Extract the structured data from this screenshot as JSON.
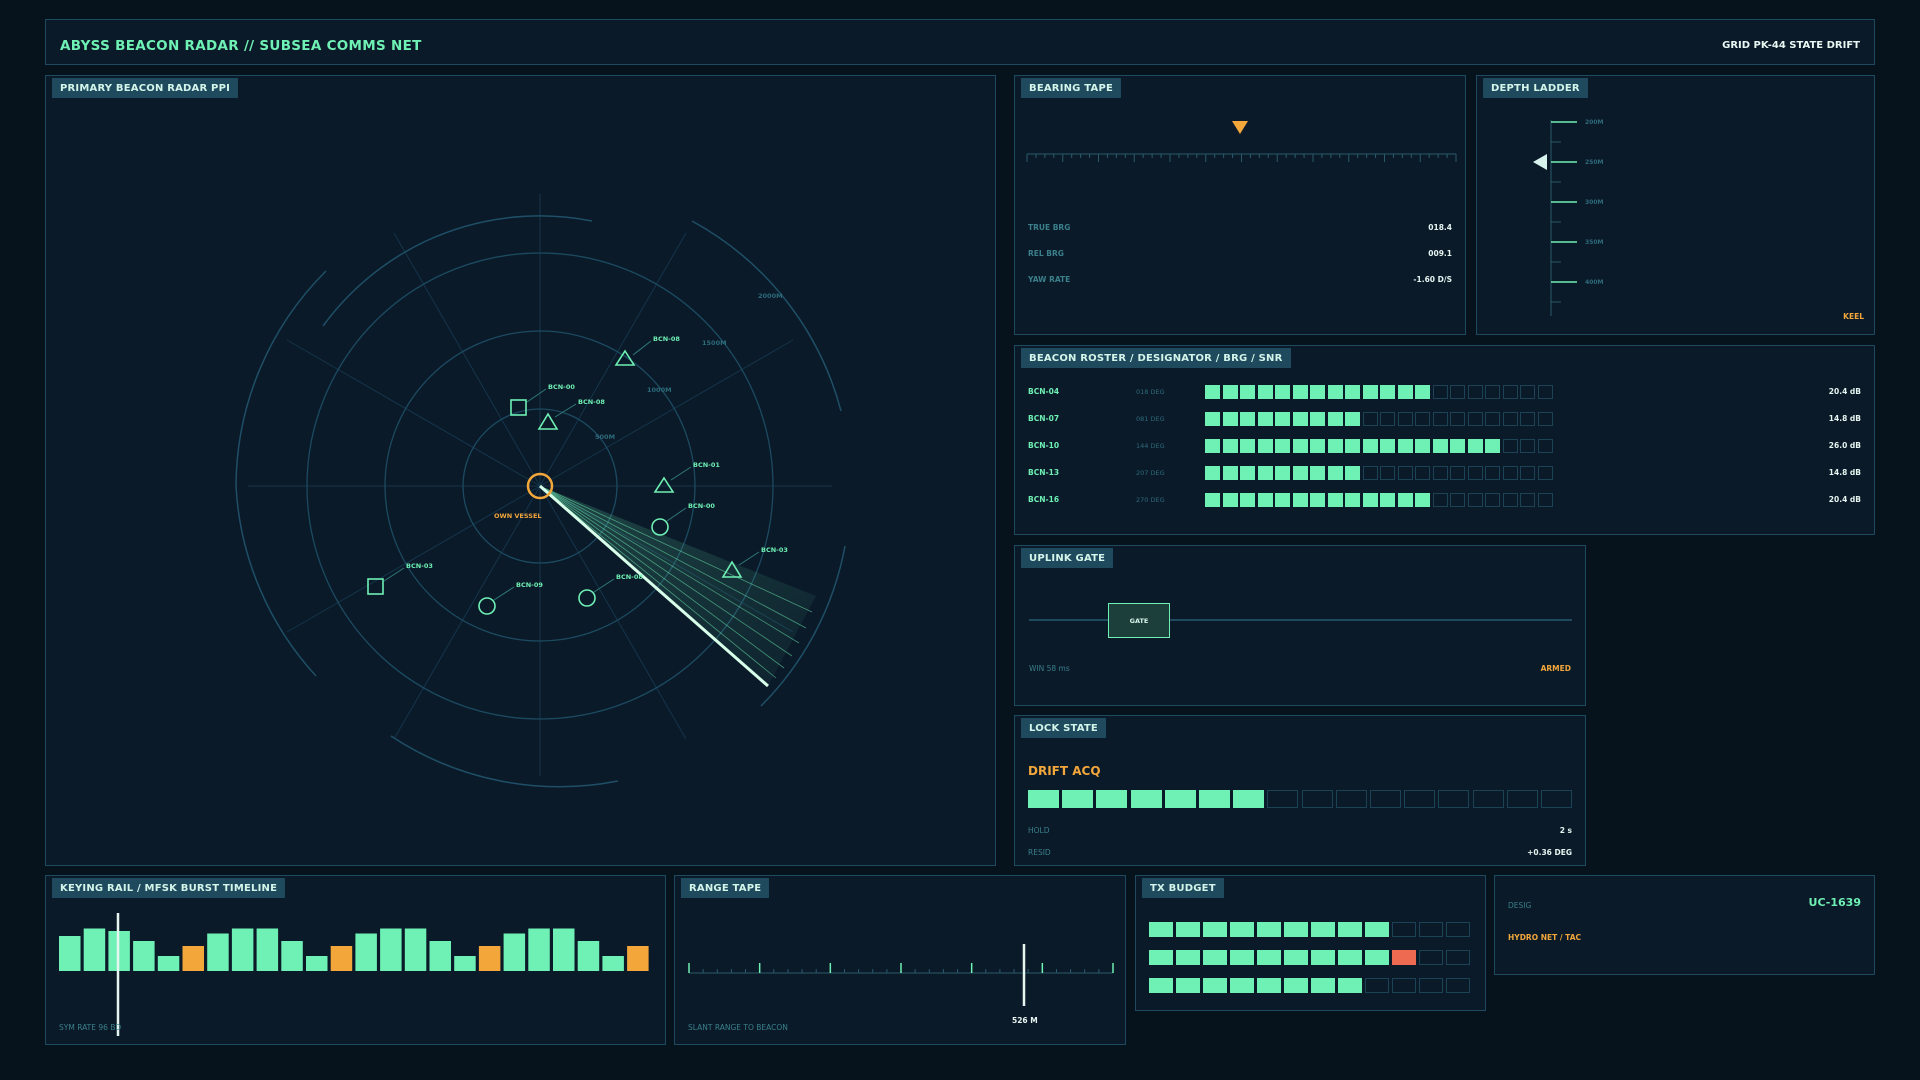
{
  "header": {
    "title": "ABYSS BEACON RADAR  //  SUBSEA COMMS NET",
    "status": "GRID PK-44  STATE DRIFT"
  },
  "radar": {
    "tag": "PRIMARY  BEACON RADAR PPI",
    "own_vessel": "OWN VESSEL",
    "ranges": [
      "500M",
      "1000M",
      "1500M",
      "2000M"
    ],
    "beacons": [
      {
        "id": "BCN-08",
        "shape": "triangle"
      },
      {
        "id": "BCN-00",
        "shape": "square"
      },
      {
        "id": "BCN-08",
        "shape": "triangle"
      },
      {
        "id": "BCN-01",
        "shape": "triangle"
      },
      {
        "id": "BCN-00",
        "shape": "circle"
      },
      {
        "id": "BCN-03",
        "shape": "triangle"
      },
      {
        "id": "BCN-03",
        "shape": "square"
      },
      {
        "id": "BCN-09",
        "shape": "circle"
      },
      {
        "id": "BCN-08",
        "shape": "circle"
      }
    ]
  },
  "bearing": {
    "tag": "BEARING TAPE",
    "rows": [
      {
        "label": "TRUE BRG",
        "value": "018.4"
      },
      {
        "label": "REL BRG",
        "value": "009.1"
      },
      {
        "label": "YAW RATE",
        "value": "-1.60 D/S"
      }
    ]
  },
  "depth": {
    "tag": "DEPTH LADDER",
    "marks": [
      "200M",
      "250M",
      "300M",
      "350M",
      "400M"
    ],
    "keel": "KEEL"
  },
  "roster": {
    "tag": "BEACON ROSTER  /  DESIGNATOR / BRG / SNR",
    "rows": [
      {
        "id": "BCN-04",
        "brg": "018 DEG",
        "snr": "20.4 dB",
        "level": 13
      },
      {
        "id": "BCN-07",
        "brg": "081 DEG",
        "snr": "14.8 dB",
        "level": 9
      },
      {
        "id": "BCN-10",
        "brg": "144 DEG",
        "snr": "26.0 dB",
        "level": 17
      },
      {
        "id": "BCN-13",
        "brg": "207 DEG",
        "snr": "14.8 dB",
        "level": 9
      },
      {
        "id": "BCN-16",
        "brg": "270 DEG",
        "snr": "20.4 dB",
        "level": 13
      }
    ]
  },
  "uplink": {
    "tag": "UPLINK GATE",
    "gate": "GATE",
    "win": "WIN 58 ms",
    "state": "ARMED"
  },
  "lock": {
    "tag": "LOCK STATE",
    "state": "DRIFT ACQ",
    "level": 7,
    "hold_label": "HOLD",
    "hold_value": "2 s",
    "resid_label": "RESID",
    "resid_value": "+0.36 DEG"
  },
  "keying": {
    "tag": "KEYING RAIL  /  MFSK BURST TIMELINE",
    "footer": "SYM RATE 96 BD",
    "bars": [
      {
        "h": 0.7,
        "amber": false
      },
      {
        "h": 0.85,
        "amber": false
      },
      {
        "h": 0.8,
        "amber": false
      },
      {
        "h": 0.6,
        "amber": false
      },
      {
        "h": 0.3,
        "amber": false
      },
      {
        "h": 0.5,
        "amber": true
      },
      {
        "h": 0.75,
        "amber": false
      },
      {
        "h": 0.85,
        "amber": false
      },
      {
        "h": 0.85,
        "amber": false
      },
      {
        "h": 0.6,
        "amber": false
      },
      {
        "h": 0.3,
        "amber": false
      },
      {
        "h": 0.5,
        "amber": true
      },
      {
        "h": 0.75,
        "amber": false
      },
      {
        "h": 0.85,
        "amber": false
      },
      {
        "h": 0.85,
        "amber": false
      },
      {
        "h": 0.6,
        "amber": false
      },
      {
        "h": 0.3,
        "amber": false
      },
      {
        "h": 0.5,
        "amber": true
      },
      {
        "h": 0.75,
        "amber": false
      },
      {
        "h": 0.85,
        "amber": false
      },
      {
        "h": 0.85,
        "amber": false
      },
      {
        "h": 0.6,
        "amber": false
      },
      {
        "h": 0.3,
        "amber": false
      },
      {
        "h": 0.5,
        "amber": true
      }
    ]
  },
  "range": {
    "tag": "RANGE TAPE",
    "footer": "SLANT RANGE TO BEACON",
    "value": "526 M"
  },
  "tx": {
    "tag": "TX BUDGET",
    "rows": [
      {
        "level": 9,
        "alert": false
      },
      {
        "level": 10,
        "alert": true
      },
      {
        "level": 8,
        "alert": false
      }
    ]
  },
  "desig": {
    "label": "DESIG",
    "value": "UC-1639",
    "net": "HYDRO NET / TAC"
  },
  "colors": {
    "accent": "#6ff0b4",
    "amber": "#f3a73b",
    "alert": "#ee6b52",
    "panel": "#0a1a29",
    "border": "#1d4a5f"
  }
}
